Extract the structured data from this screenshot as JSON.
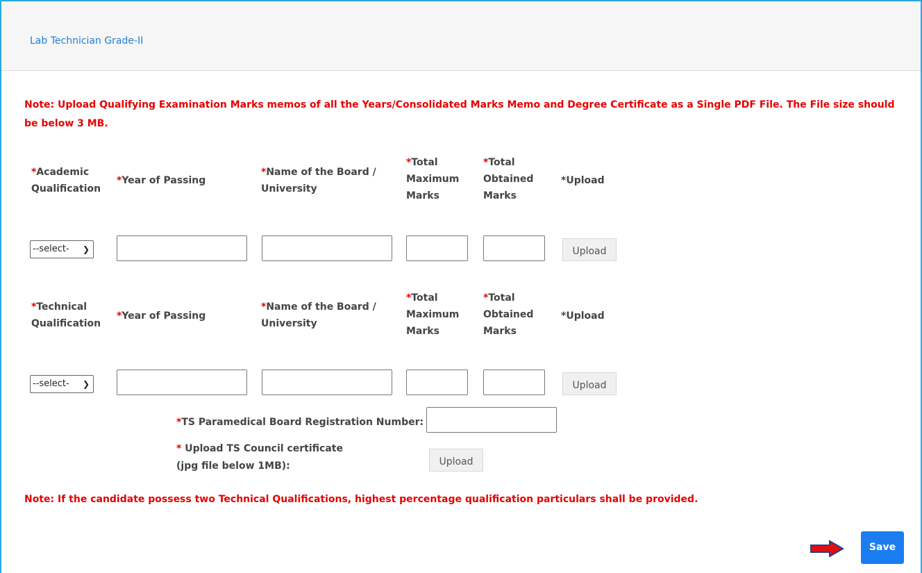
{
  "panel": {
    "title": "Lab Technician Grade-II"
  },
  "notes": {
    "upload_note": "Note: Upload Qualifying Examination Marks memos of all the Years/Consolidated Marks Memo and Degree Certificate as a Single PDF File. The File size should be below 3 MB.",
    "technical_note": "Note: If the candidate possess two Technical Qualifications, highest percentage qualification particulars shall be provided."
  },
  "academic": {
    "col_qualification": "Academic Qualification",
    "col_year": "Year of Passing",
    "col_board": "Name of the Board / University",
    "col_max": "Total Maximum Marks",
    "col_obtained": "Total Obtained Marks",
    "col_upload": "Upload",
    "select_value": "--select-",
    "upload_label": "Upload"
  },
  "technical": {
    "col_qualification": "Technical Qualification",
    "col_year": "Year of Passing",
    "col_board": "Name of the Board / University",
    "col_max": "Total Maximum Marks",
    "col_obtained": "Total Obtained Marks",
    "col_upload": "Upload",
    "select_value": "--select-",
    "upload_label": "Upload"
  },
  "registration": {
    "label": "TS Paramedical Board Registration Number:",
    "council_label": "Upload TS Council certificate (jpg file below 1MB):",
    "upload_label": "Upload"
  },
  "actions": {
    "save_label": "Save"
  },
  "colors": {
    "accent": "#1a7df0",
    "required": "#e60000",
    "border": "#29a8e0",
    "arrow": "#e01010"
  },
  "icons": {
    "arrow": "right-arrow-icon",
    "dropdown": "chevron-down-icon"
  }
}
